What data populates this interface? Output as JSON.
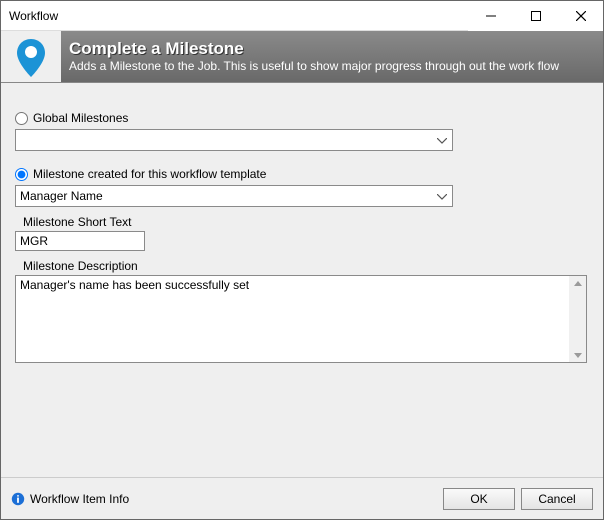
{
  "window": {
    "title": "Workflow"
  },
  "banner": {
    "title": "Complete a Milestone",
    "subtitle": "Adds a Milestone to the Job.  This is useful to show major progress through out the work flow"
  },
  "form": {
    "global_radio_label": "Global Milestones",
    "global_selected": "",
    "template_radio_label": "Milestone created for this workflow template",
    "template_selected": "Manager Name",
    "short_text_label": "Milestone Short Text",
    "short_text_value": "MGR",
    "description_label": "Milestone Description",
    "description_value": "Manager's name has been successfully set"
  },
  "footer": {
    "info_label": "Workflow Item Info",
    "ok_label": "OK",
    "cancel_label": "Cancel"
  }
}
